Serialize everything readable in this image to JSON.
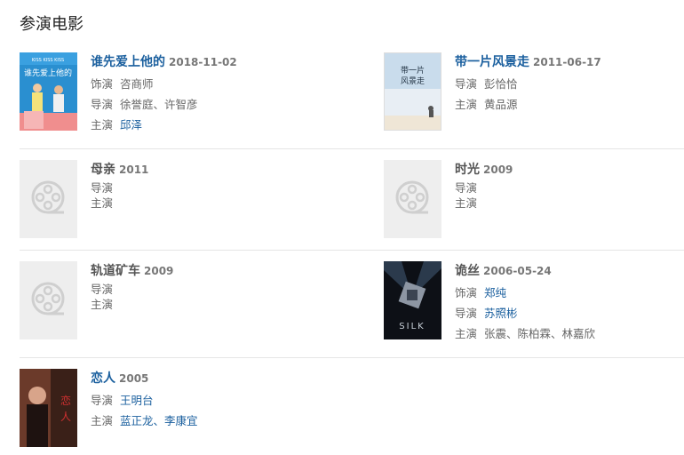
{
  "section": {
    "title": "参演电影"
  },
  "labels": {
    "role": "饰演",
    "director": "导演",
    "cast": "主演"
  },
  "movies": [
    {
      "title": "谁先爱上他的",
      "date": "2018-11-02",
      "role": "咨商师",
      "director": "徐誉庭、许智彦",
      "cast": "邱泽",
      "poster": "poster-who-killed"
    },
    {
      "title": "带一片风景走",
      "date": "2011-06-17",
      "role": "",
      "director": "彭恰恰",
      "cast": "黄品源",
      "poster": "poster-scenery"
    },
    {
      "title": "母亲",
      "date": "2011",
      "role": "",
      "director": "",
      "cast": "",
      "poster": "placeholder"
    },
    {
      "title": "时光",
      "date": "2009",
      "role": "",
      "director": "",
      "cast": "",
      "poster": "placeholder"
    },
    {
      "title": "轨道矿车",
      "date": "2009",
      "role": "",
      "director": "",
      "cast": "",
      "poster": "placeholder"
    },
    {
      "title": "诡丝",
      "date": "2006-05-24",
      "role": "郑纯",
      "director": "苏照彬",
      "cast": "张震、陈柏霖、林嘉欣",
      "poster": "poster-silk"
    },
    {
      "title": "恋人",
      "date": "2005",
      "role": "",
      "director": "王明台",
      "cast": "蓝正龙、李康宜",
      "poster": "poster-lovers"
    }
  ]
}
